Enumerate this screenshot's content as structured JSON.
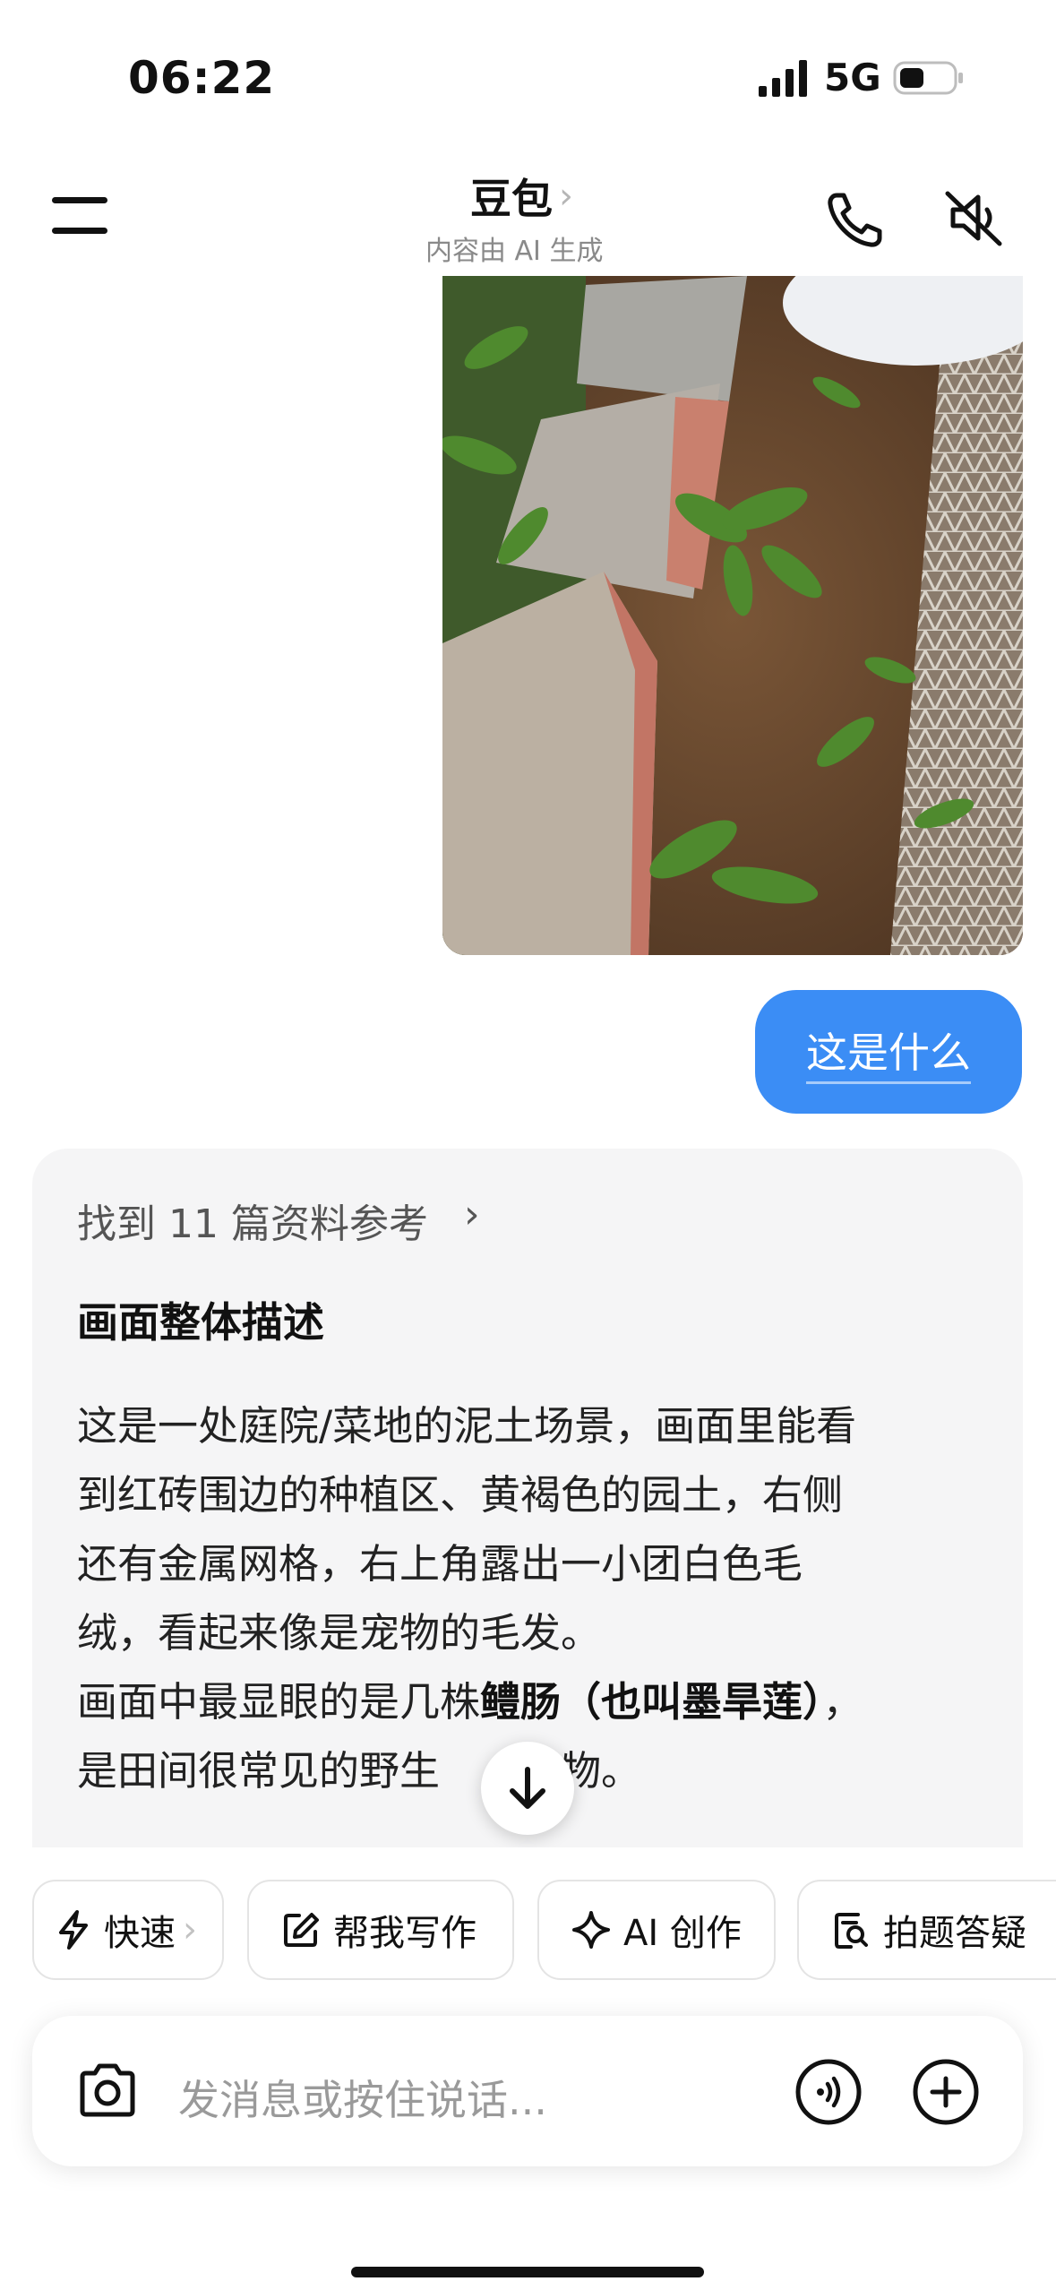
{
  "status_bar": {
    "time": "06:22",
    "network": "5G"
  },
  "header": {
    "title": "豆包",
    "subtitle": "内容由 AI 生成"
  },
  "conversation": {
    "user_message": "这是什么",
    "ai_response": {
      "references": "找到 11 篇资料参考",
      "heading": "画面整体描述",
      "para1_l1": "这是一处庭院/菜地的泥土场景，画面里能看",
      "para1_l2": "到红砖围边的种植区、黄褐色的园土，右侧",
      "para1_l3": "还有金属网格，右上角露出一小团白色毛",
      "para1_l4": "绒，看起来像是宠物的毛发。",
      "para2_pre": "画面中最显眼的是几株",
      "para2_bold": "鳢肠（也叫墨旱莲）",
      "para2_post": "，",
      "para3_a": "是田间很常见的野生",
      "para3_b": "植物。"
    }
  },
  "quick_actions": [
    {
      "label": "快速",
      "icon": "lightning-icon"
    },
    {
      "label": "帮我写作",
      "icon": "edit-icon"
    },
    {
      "label": "AI 创作",
      "icon": "sparkle-icon"
    },
    {
      "label": "拍题答疑",
      "icon": "search-doc-icon"
    }
  ],
  "input": {
    "placeholder": "发消息或按住说话..."
  },
  "colors": {
    "accent": "#3b8df5",
    "card_bg": "#f5f5f6"
  }
}
